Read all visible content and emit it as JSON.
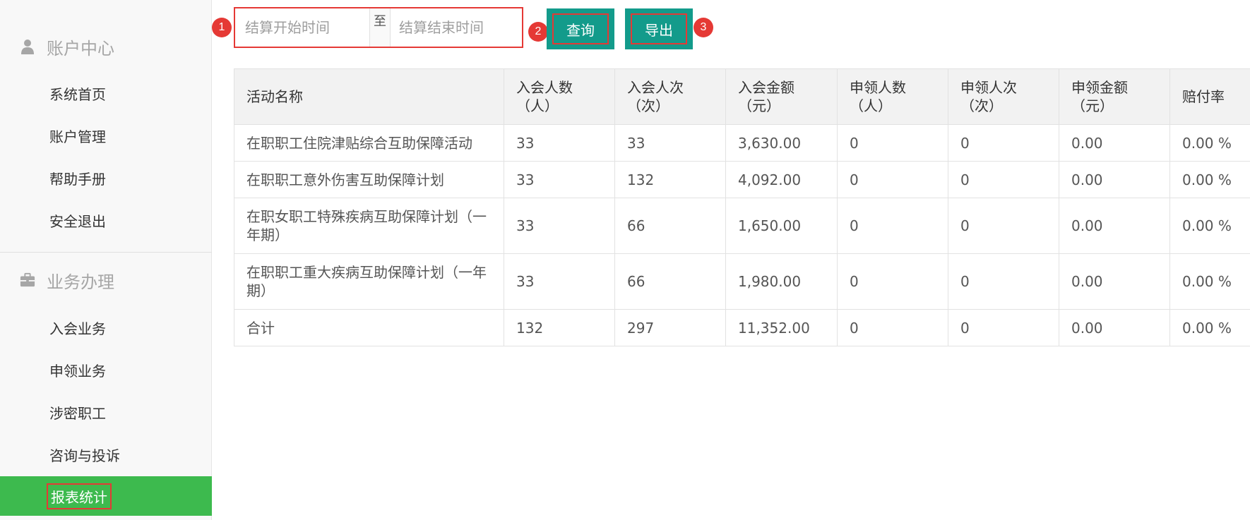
{
  "sidebar": {
    "section1": {
      "label": "账户中心",
      "icon": "user-icon"
    },
    "section1_items": [
      {
        "label": "系统首页"
      },
      {
        "label": "账户管理"
      },
      {
        "label": "帮助手册"
      },
      {
        "label": "安全退出"
      }
    ],
    "section2": {
      "label": "业务办理",
      "icon": "briefcase-icon"
    },
    "section2_items": [
      {
        "label": "入会业务"
      },
      {
        "label": "申领业务"
      },
      {
        "label": "涉密职工"
      },
      {
        "label": "咨询与投诉"
      },
      {
        "label": "报表统计",
        "active": true
      }
    ]
  },
  "toolbar": {
    "start_placeholder": "结算开始时间",
    "start_value": "",
    "separator": "至",
    "end_placeholder": "结算结束时间",
    "end_value": "",
    "query_label": "查询",
    "export_label": "导出",
    "badges": [
      "1",
      "2",
      "3"
    ]
  },
  "table": {
    "headers": [
      {
        "line1": "活动名称",
        "line2": ""
      },
      {
        "line1": "入会人数",
        "line2": "（人）"
      },
      {
        "line1": "入会人次",
        "line2": "（次）"
      },
      {
        "line1": "入会金额",
        "line2": "（元）"
      },
      {
        "line1": "申领人数",
        "line2": "（人）"
      },
      {
        "line1": "申领人次",
        "line2": "（次）"
      },
      {
        "line1": "申领金额",
        "line2": "（元）"
      },
      {
        "line1": "赔付率",
        "line2": ""
      }
    ],
    "rows": [
      [
        "在职职工住院津贴综合互助保障活动",
        "33",
        "33",
        "3,630.00",
        "0",
        "0",
        "0.00",
        "0.00 %"
      ],
      [
        "在职职工意外伤害互助保障计划",
        "33",
        "132",
        "4,092.00",
        "0",
        "0",
        "0.00",
        "0.00 %"
      ],
      [
        "在职女职工特殊疾病互助保障计划（一年期）",
        "33",
        "66",
        "1,650.00",
        "0",
        "0",
        "0.00",
        "0.00 %"
      ],
      [
        "在职职工重大疾病互助保障计划（一年期）",
        "33",
        "66",
        "1,980.00",
        "0",
        "0",
        "0.00",
        "0.00 %"
      ],
      [
        "合计",
        "132",
        "297",
        "11,352.00",
        "0",
        "0",
        "0.00",
        "0.00 %"
      ]
    ]
  },
  "colors": {
    "primary_button": "#139b8b",
    "active_nav": "#3dba4e",
    "highlight": "#e53935"
  }
}
